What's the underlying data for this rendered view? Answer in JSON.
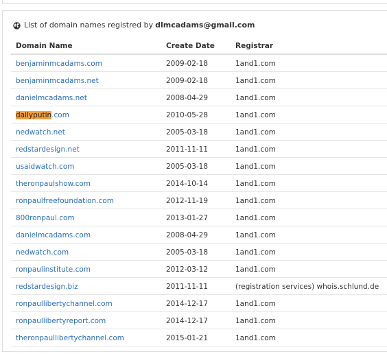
{
  "panel": {
    "title_prefix": "List of domain names registred by",
    "title_email": "dlmcadams@gmail.com"
  },
  "table": {
    "headers": [
      "Domain Name",
      "Create Date",
      "Registrar"
    ],
    "highlight_color": "#f0a040",
    "link_color": "#2a6ebb",
    "rows": [
      {
        "domain_hl": "",
        "domain_rest": "benjaminmcadams.com",
        "date": "2009-02-18",
        "registrar": "1and1.com"
      },
      {
        "domain_hl": "",
        "domain_rest": "benjaminmcadams.net",
        "date": "2009-02-18",
        "registrar": "1and1.com"
      },
      {
        "domain_hl": "",
        "domain_rest": "danielmcadams.net",
        "date": "2008-04-29",
        "registrar": "1and1.com"
      },
      {
        "domain_hl": "dailyputin",
        "domain_rest": ".com",
        "date": "2010-05-28",
        "registrar": "1and1.com"
      },
      {
        "domain_hl": "",
        "domain_rest": "nedwatch.net",
        "date": "2005-03-18",
        "registrar": "1and1.com"
      },
      {
        "domain_hl": "",
        "domain_rest": "redstardesign.net",
        "date": "2011-11-11",
        "registrar": "1and1.com"
      },
      {
        "domain_hl": "",
        "domain_rest": "usaidwatch.com",
        "date": "2005-03-18",
        "registrar": "1and1.com"
      },
      {
        "domain_hl": "",
        "domain_rest": "theronpaulshow.com",
        "date": "2014-10-14",
        "registrar": "1and1.com"
      },
      {
        "domain_hl": "",
        "domain_rest": "ronpaulfreefoundation.com",
        "date": "2012-11-19",
        "registrar": "1and1.com"
      },
      {
        "domain_hl": "",
        "domain_rest": "800ronpaul.com",
        "date": "2013-01-27",
        "registrar": "1and1.com"
      },
      {
        "domain_hl": "",
        "domain_rest": "danielmcadams.com",
        "date": "2008-04-29",
        "registrar": "1and1.com"
      },
      {
        "domain_hl": "",
        "domain_rest": "nedwatch.com",
        "date": "2005-03-18",
        "registrar": "1and1.com"
      },
      {
        "domain_hl": "",
        "domain_rest": "ronpaulinstitute.com",
        "date": "2012-03-12",
        "registrar": "1and1.com"
      },
      {
        "domain_hl": "",
        "domain_rest": "redstardesign.biz",
        "date": "2011-11-11",
        "registrar": "(registration services) whois.schlund.de"
      },
      {
        "domain_hl": "",
        "domain_rest": "ronpaullibertychannel.com",
        "date": "2014-12-17",
        "registrar": "1and1.com"
      },
      {
        "domain_hl": "",
        "domain_rest": "ronpaullibertyreport.com",
        "date": "2014-12-17",
        "registrar": "1and1.com"
      },
      {
        "domain_hl": "",
        "domain_rest": "theronpaullibertychannel.com",
        "date": "2015-01-21",
        "registrar": "1and1.com"
      }
    ]
  }
}
